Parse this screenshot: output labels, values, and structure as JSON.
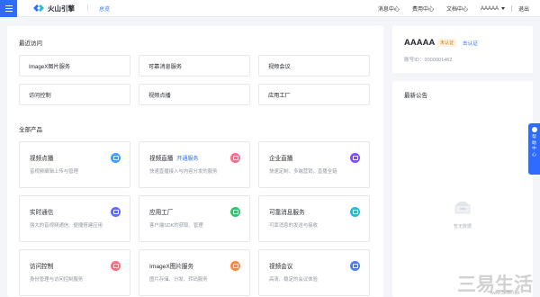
{
  "header": {
    "brand": "火山引擎",
    "nav_overview": "总览",
    "links": [
      "消息中心",
      "费用中心",
      "文档中心"
    ],
    "user": "AAAAA",
    "logout": "退出"
  },
  "recent": {
    "title": "最近访问",
    "items": [
      "ImageX图片服务",
      "可靠消息服务",
      "视频会议",
      "访问控制",
      "视频点播",
      "应用工厂"
    ]
  },
  "products": {
    "title": "全部产品",
    "items": [
      {
        "name": "视频点播",
        "desc": "音视频编辑上传与管理",
        "color": "#3aa0ff",
        "icon": "video-icon"
      },
      {
        "name": "视频直播",
        "tag": "开通服务",
        "desc": "快速直播接入与内容分发的服务",
        "color": "#ff6b8b",
        "icon": "live-icon"
      },
      {
        "name": "企业直播",
        "desc": "快速定制、多端营销，直播全链",
        "color": "#7b4dff",
        "icon": "broadcast-icon"
      },
      {
        "name": "实时通信",
        "desc": "强大的音视频通信、便捷搭建应用",
        "color": "#5b6cff",
        "icon": "rtc-icon"
      },
      {
        "name": "应用工厂",
        "desc": "客户端SDK的获取、管理",
        "color": "#36c26b",
        "icon": "app-icon"
      },
      {
        "name": "可靠消息服务",
        "desc": "可靠消息的发送与接收",
        "color": "#2bb5d6",
        "icon": "message-icon"
      },
      {
        "name": "访问控制",
        "desc": "身份管理与访问控制服务",
        "color": "#ff6b7a",
        "icon": "access-icon"
      },
      {
        "name": "ImageX图片服务",
        "desc": "图片存储、分发、转码服务",
        "color": "#ff8a3d",
        "icon": "image-icon"
      },
      {
        "name": "视频会议",
        "desc": "高清、稳定的会议体验",
        "color": "#4b7bff",
        "icon": "meeting-icon"
      }
    ]
  },
  "account": {
    "name": "AAAAA",
    "badge": "未认证",
    "link": "去认证",
    "id_label": "账号ID：2000001462"
  },
  "notice": {
    "title": "最新公告",
    "empty": "暂无数据"
  },
  "float_tab": {
    "chars": [
      "帮",
      "助",
      "中",
      "心"
    ]
  },
  "watermark": {
    "text": "三易生活",
    "url": "www.3elife.net"
  }
}
